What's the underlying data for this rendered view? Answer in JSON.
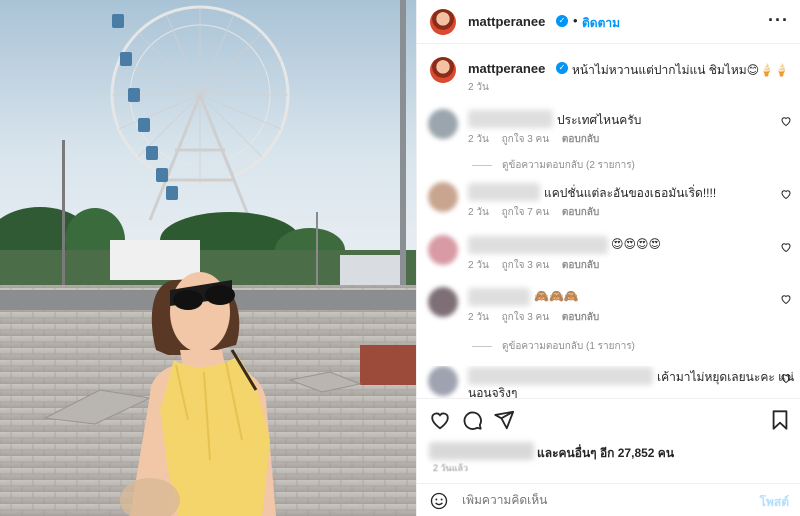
{
  "header": {
    "username": "mattperanee",
    "separator": "•",
    "follow_label": "ติดตาม",
    "more_icon": "more-horizontal-icon"
  },
  "caption": {
    "username": "mattperanee",
    "text": "หน้าไม่หวานแต่ปากไม่แน่ ชิมไหม😊🍦🍦",
    "time": "2 วัน"
  },
  "comments": [
    {
      "text": "ประเทศไหนครับ",
      "time": "2 วัน",
      "likes": "ถูกใจ 3 คน",
      "reply_label": "ตอบกลับ",
      "view_replies": "ดูข้อความตอบกลับ (2 รายการ)"
    },
    {
      "text": "แคปชั่นแต่ละอันของเธอมันเริ่ด!!!!",
      "time": "2 วัน",
      "likes": "ถูกใจ 7 คน",
      "reply_label": "ตอบกลับ"
    },
    {
      "text": "😍😍😍😍",
      "time": "2 วัน",
      "likes": "ถูกใจ 3 คน",
      "reply_label": "ตอบกลับ"
    },
    {
      "text": "🙈🙈🙈",
      "time": "2 วัน",
      "likes": "ถูกใจ 3 คน",
      "reply_label": "ตอบกลับ",
      "view_replies": "ดูข้อความตอบกลับ (1 รายการ)"
    },
    {
      "text_line1": "เค้ามาไม่หยุดเลยนะคะ แน่",
      "text_line2": "นอนจริงๆ"
    }
  ],
  "likes": {
    "text": "และคนอื่นๆ อีก 27,852 คน"
  },
  "post_time": "2 วันแล้ว",
  "add_comment": {
    "placeholder": "เพิ่มความคิดเห็น",
    "post_label": "โพสต์"
  },
  "colors": {
    "accent": "#0095f6",
    "text": "#262626",
    "muted": "#8e8e8e",
    "post_disabled": "#b2dffc"
  }
}
